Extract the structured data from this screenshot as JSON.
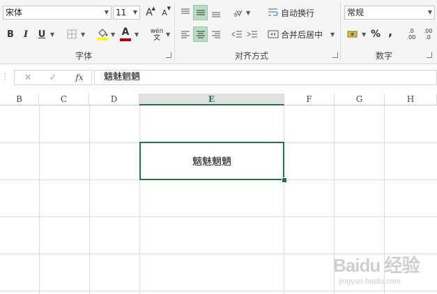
{
  "ribbon": {
    "font_group": {
      "label": "字体",
      "font_name": "宋体",
      "font_size": "11",
      "grow_label": "A",
      "shrink_label": "A",
      "bold": "B",
      "italic": "I",
      "underline": "U",
      "font_color_label": "A",
      "font_color": "#c00000",
      "fill_color": "#ffff00",
      "phonetic_top": "wén",
      "phonetic_bottom": "文"
    },
    "align_group": {
      "label": "对齐方式",
      "wrap_text": "自动换行",
      "merge_center": "合并后居中"
    },
    "number_group": {
      "label": "数字",
      "format": "常规",
      "percent": "%",
      "comma": ",",
      "inc_decimal": ".0 .00",
      "dec_decimal": ".00 .0"
    }
  },
  "formula_bar": {
    "fx_label": "fx",
    "content": "魑魅魍魉"
  },
  "columns": [
    "B",
    "C",
    "D",
    "E",
    "F",
    "G",
    "H"
  ],
  "selected_column": "E",
  "selected_cell_text": "魑魅魍魉",
  "watermark": {
    "brand": "Baidu 经验",
    "url": "jingyan.baidu.com"
  },
  "colors": {
    "accent": "#217346",
    "selected_button_bg": "#b9dcc4"
  }
}
